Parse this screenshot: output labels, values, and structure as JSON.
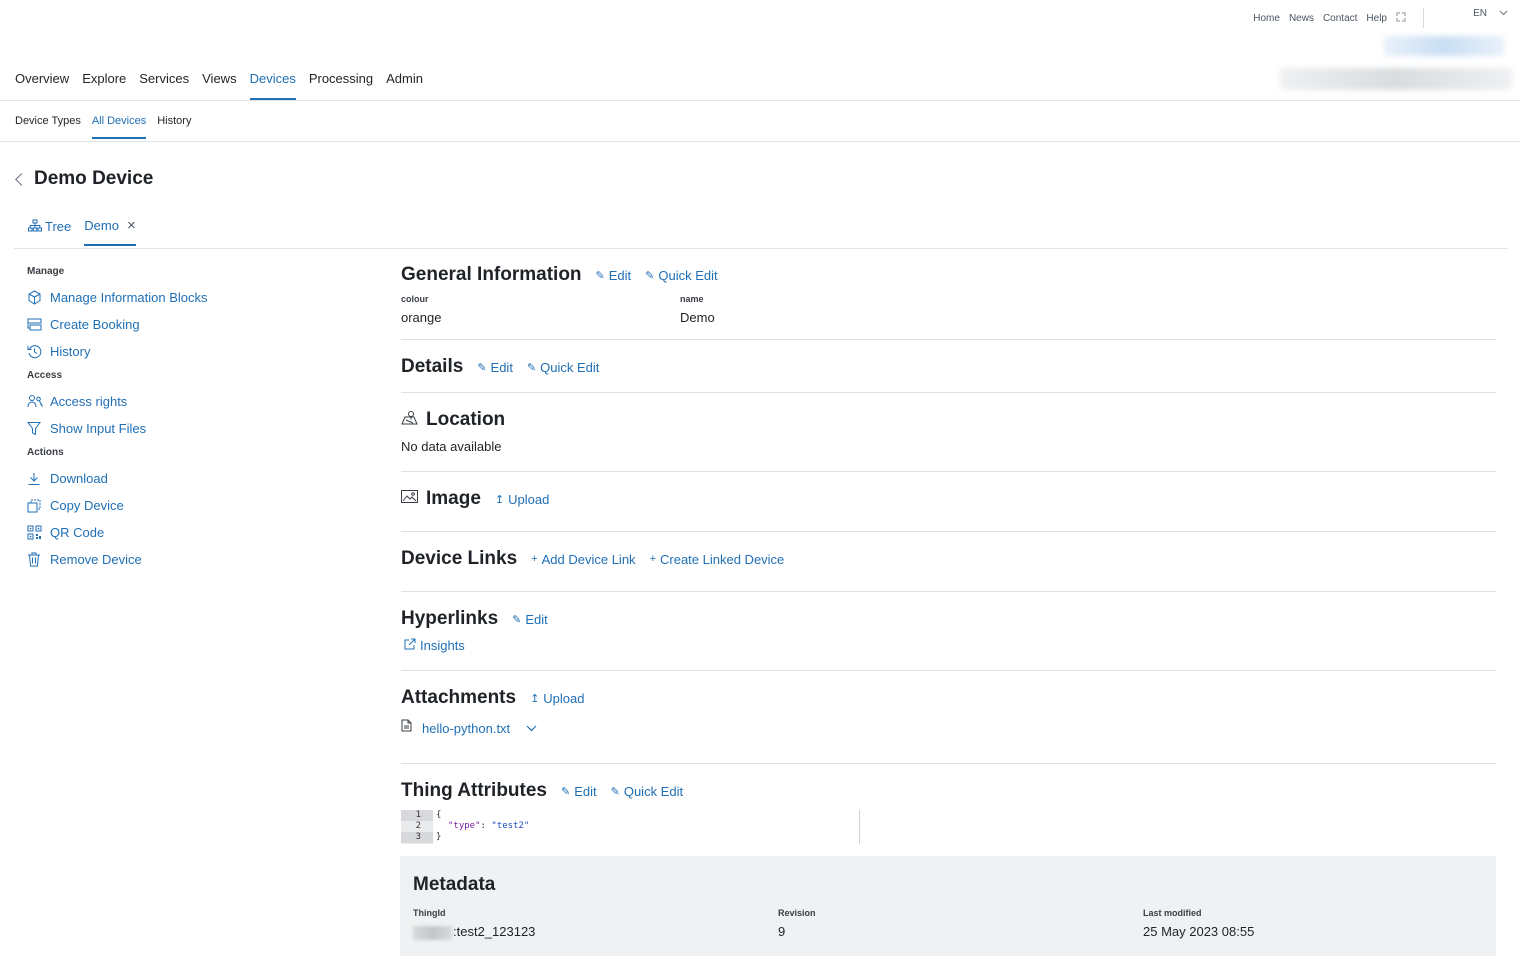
{
  "top_links": [
    "Home",
    "News",
    "Contact",
    "Help"
  ],
  "language": "EN",
  "main_nav": [
    {
      "label": "Overview"
    },
    {
      "label": "Explore"
    },
    {
      "label": "Services"
    },
    {
      "label": "Views"
    },
    {
      "label": "Devices",
      "active": true
    },
    {
      "label": "Processing"
    },
    {
      "label": "Admin"
    }
  ],
  "sub_nav": [
    {
      "label": "Device Types"
    },
    {
      "label": "All Devices",
      "active": true
    },
    {
      "label": "History"
    }
  ],
  "page_title": "Demo Device",
  "tabs": {
    "tree": "Tree",
    "demo": "Demo"
  },
  "sidebar": {
    "manage_label": "Manage",
    "manage": [
      "Manage Information Blocks",
      "Create Booking",
      "History"
    ],
    "access_label": "Access",
    "access": [
      "Access rights",
      "Show Input Files"
    ],
    "actions_label": "Actions",
    "actions": [
      "Download",
      "Copy Device",
      "QR Code",
      "Remove Device"
    ]
  },
  "general": {
    "title": "General Information",
    "edit": "Edit",
    "quick_edit": "Quick Edit",
    "fields": [
      {
        "label": "colour",
        "value": "orange"
      },
      {
        "label": "name",
        "value": "Demo"
      }
    ]
  },
  "details": {
    "title": "Details",
    "edit": "Edit",
    "quick_edit": "Quick Edit"
  },
  "location": {
    "title": "Location",
    "empty": "No data available"
  },
  "image": {
    "title": "Image",
    "upload": "Upload"
  },
  "device_links": {
    "title": "Device Links",
    "add": "Add Device Link",
    "create": "Create Linked Device"
  },
  "hyperlinks": {
    "title": "Hyperlinks",
    "edit": "Edit",
    "link": "Insights"
  },
  "attachments": {
    "title": "Attachments",
    "upload": "Upload",
    "file": "hello-python.txt"
  },
  "thing_attributes": {
    "title": "Thing Attributes",
    "edit": "Edit",
    "quick_edit": "Quick Edit",
    "code_line_numbers": [
      "1",
      "2",
      "3"
    ],
    "code_open": "{",
    "code_key": "\"type\"",
    "code_colon": ": ",
    "code_value": "\"test2\"",
    "code_close": "}"
  },
  "metadata": {
    "title": "Metadata",
    "thing_id_label": "ThingId",
    "thing_id_value": ":test2_123123",
    "revision_label": "Revision",
    "revision_value": "9",
    "modified_label": "Last modified",
    "modified_value": "25 May 2023 08:55"
  }
}
